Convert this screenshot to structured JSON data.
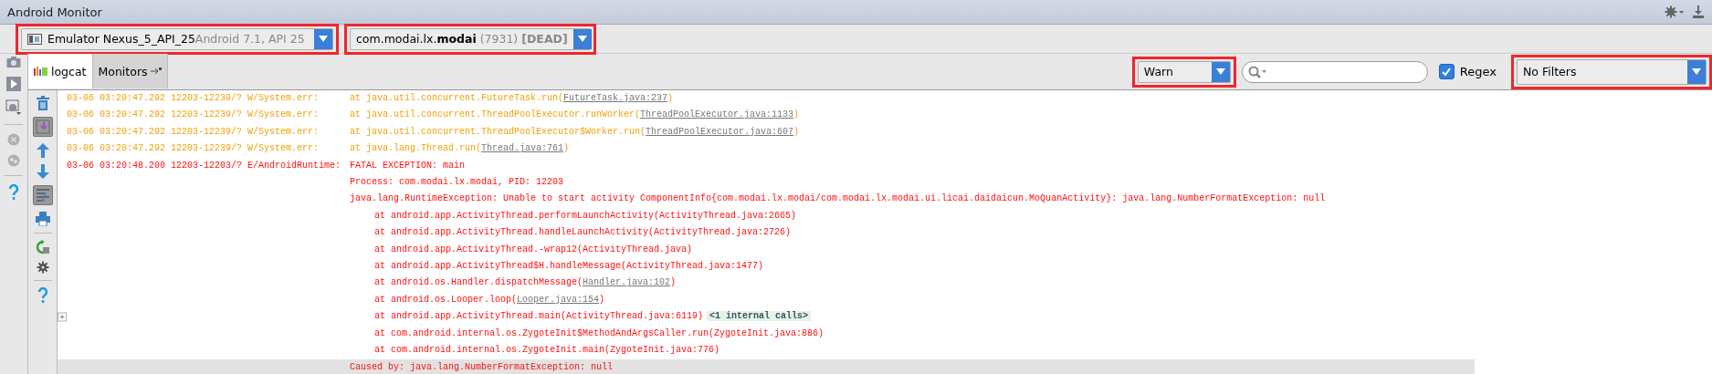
{
  "window": {
    "title": "Android Monitor"
  },
  "device_selector": {
    "name": "Emulator Nexus_5_API_25",
    "detail": "Android 7.1, API 25",
    "highlighted": true
  },
  "process_selector": {
    "package": "com.modai.lx.**modai**",
    "pid": "(7931)",
    "status": "[DEAD]",
    "highlighted": true
  },
  "tabs": [
    {
      "label": "logcat",
      "selected": true
    },
    {
      "label": "Monitors",
      "selected": false
    }
  ],
  "log_level": {
    "value": "Warn",
    "highlighted": true
  },
  "regex": {
    "label": "Regex",
    "checked": true
  },
  "filter": {
    "value": "No Filters",
    "highlighted": true
  },
  "log_lines": [
    {
      "kind": "warn",
      "header": "03-06 03:20:47.292 12203-12239/? W/System.err:",
      "indented": false,
      "parts": [
        {
          "kind": "plain",
          "text": "at java.util.concurrent.FutureTask.run("
        },
        {
          "kind": "link",
          "text": "FutureTask.java:237"
        },
        {
          "kind": "plain",
          "text": ")"
        }
      ]
    },
    {
      "kind": "warn",
      "header": "03-06 03:20:47.292 12203-12239/? W/System.err:",
      "indented": false,
      "parts": [
        {
          "kind": "plain",
          "text": "at java.util.concurrent.ThreadPoolExecutor.runWorker("
        },
        {
          "kind": "link",
          "text": "ThreadPoolExecutor.java:1133"
        },
        {
          "kind": "plain",
          "text": ")"
        }
      ]
    },
    {
      "kind": "warn",
      "header": "03-06 03:20:47.292 12203-12239/? W/System.err:",
      "indented": false,
      "parts": [
        {
          "kind": "plain",
          "text": "at java.util.concurrent.ThreadPoolExecutor$Worker.run("
        },
        {
          "kind": "link",
          "text": "ThreadPoolExecutor.java:607"
        },
        {
          "kind": "plain",
          "text": ")"
        }
      ]
    },
    {
      "kind": "warn",
      "header": "03-06 03:20:47.292 12203-12239/? W/System.err:",
      "indented": false,
      "parts": [
        {
          "kind": "plain",
          "text": "at java.lang.Thread.run("
        },
        {
          "kind": "link",
          "text": "Thread.java:761"
        },
        {
          "kind": "plain",
          "text": ")"
        }
      ]
    },
    {
      "kind": "error",
      "header": "03-06 03:20:48.200 12203-12203/? E/AndroidRuntime:",
      "indented": false,
      "parts": [
        {
          "kind": "plain",
          "text": "FATAL EXCEPTION: main"
        }
      ]
    },
    {
      "kind": "error",
      "indented": false,
      "parts": [
        {
          "kind": "plain",
          "text": "Process: com.modai.lx.modai, PID: 12203"
        }
      ]
    },
    {
      "kind": "error",
      "indented": false,
      "parts": [
        {
          "kind": "plain",
          "text": "java.lang.RuntimeException: Unable to start activity ComponentInfo{com.modai.lx.modai/com.modai.lx.modai.ui.licai.daidaicun.MoQuanActivity}: java.lang.NumberFormatException: null"
        }
      ]
    },
    {
      "kind": "error",
      "indented": true,
      "parts": [
        {
          "kind": "plain",
          "text": "at android.app.ActivityThread.performLaunchActivity(ActivityThread.java:2665)"
        }
      ]
    },
    {
      "kind": "error",
      "indented": true,
      "parts": [
        {
          "kind": "plain",
          "text": "at android.app.ActivityThread.handleLaunchActivity(ActivityThread.java:2726)"
        }
      ]
    },
    {
      "kind": "error",
      "indented": true,
      "parts": [
        {
          "kind": "plain",
          "text": "at android.app.ActivityThread.-wrap12(ActivityThread.java)"
        }
      ]
    },
    {
      "kind": "error",
      "indented": true,
      "parts": [
        {
          "kind": "plain",
          "text": "at android.app.ActivityThread$H.handleMessage(ActivityThread.java:1477)"
        }
      ]
    },
    {
      "kind": "error",
      "indented": true,
      "parts": [
        {
          "kind": "plain",
          "text": "at android.os.Handler.dispatchMessage("
        },
        {
          "kind": "link",
          "text": "Handler.java:102"
        },
        {
          "kind": "plain",
          "text": ")"
        }
      ]
    },
    {
      "kind": "error",
      "indented": true,
      "parts": [
        {
          "kind": "plain",
          "text": "at android.os.Looper.loop("
        },
        {
          "kind": "link",
          "text": "Looper.java:154"
        },
        {
          "kind": "plain",
          "text": ")"
        }
      ]
    },
    {
      "kind": "error",
      "indented": true,
      "expandable": true,
      "parts": [
        {
          "kind": "plain",
          "text": "at android.app.ActivityThread.main(ActivityThread.java:6119)"
        },
        {
          "kind": "fold",
          "text": "<1 internal calls>"
        }
      ]
    },
    {
      "kind": "error",
      "indented": true,
      "parts": [
        {
          "kind": "plain",
          "text": "at com.android.internal.os.ZygoteInit$MethodAndArgsCaller.run(ZygoteInit.java:886)"
        }
      ]
    },
    {
      "kind": "error",
      "indented": true,
      "parts": [
        {
          "kind": "plain",
          "text": "at com.android.internal.os.ZygoteInit.main(ZygoteInit.java:776)"
        }
      ]
    },
    {
      "kind": "error",
      "indented": false,
      "shaded": true,
      "parts": [
        {
          "kind": "plain",
          "text": "Caused by: java.lang.NumberFormatException: null"
        }
      ]
    }
  ]
}
